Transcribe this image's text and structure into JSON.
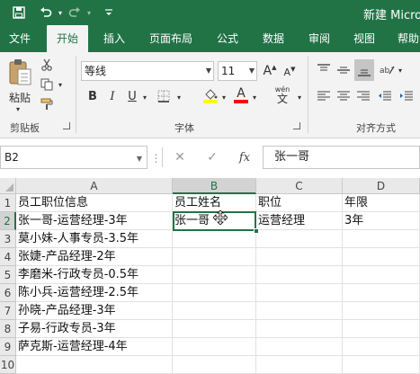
{
  "window": {
    "title": "新建 Micro"
  },
  "quick_access": {
    "save_icon": "save-icon",
    "undo_icon": "undo-icon",
    "redo_icon": "redo-icon",
    "customize_icon": "customize-icon"
  },
  "ribbon_tabs": [
    "文件",
    "开始",
    "插入",
    "页面布局",
    "公式",
    "数据",
    "审阅",
    "视图",
    "帮助"
  ],
  "active_tab": "开始",
  "ribbon": {
    "clipboard": {
      "paste_label": "粘贴",
      "group_label": "剪贴板"
    },
    "font": {
      "font_name": "等线",
      "font_size": "11",
      "group_label": "字体",
      "bold_label": "B",
      "italic_label": "I",
      "underline_label": "U",
      "font_color_label": "A",
      "grow_label": "A",
      "shrink_label": "A",
      "phonetic_label": "wén",
      "highlight_color": "#ffff00",
      "font_color": "#ff0000"
    },
    "alignment": {
      "group_label": "对齐方式"
    }
  },
  "formula_bar": {
    "name_box": "B2",
    "cancel_label": "✕",
    "enter_label": "✓",
    "fx_label": "fx",
    "formula": "张一哥"
  },
  "sheet": {
    "columns": [
      "A",
      "B",
      "C",
      "D"
    ],
    "rows": [
      "1",
      "2",
      "3",
      "4",
      "5",
      "6",
      "7",
      "8",
      "9",
      "10"
    ],
    "selected_cell": "B2",
    "cells": {
      "A1": "员工职位信息",
      "B1": "员工姓名",
      "C1": "职位",
      "D1": "年限",
      "A2": "张一哥-运营经理-3年",
      "B2": "张一哥",
      "C2": "运营经理",
      "D2": "3年",
      "A3": "莫小妹-人事专员-3.5年",
      "A4": "张婕-产品经理-2年",
      "A5": "李磨米-行政专员-0.5年",
      "A6": "陈小兵-运营经理-2.5年",
      "A7": "孙晓-产品经理-3年",
      "A8": "子易-行政专员-3年",
      "A9": "萨克斯-运营经理-4年"
    }
  },
  "colors": {
    "brand": "#217346",
    "selection": "#217346"
  }
}
